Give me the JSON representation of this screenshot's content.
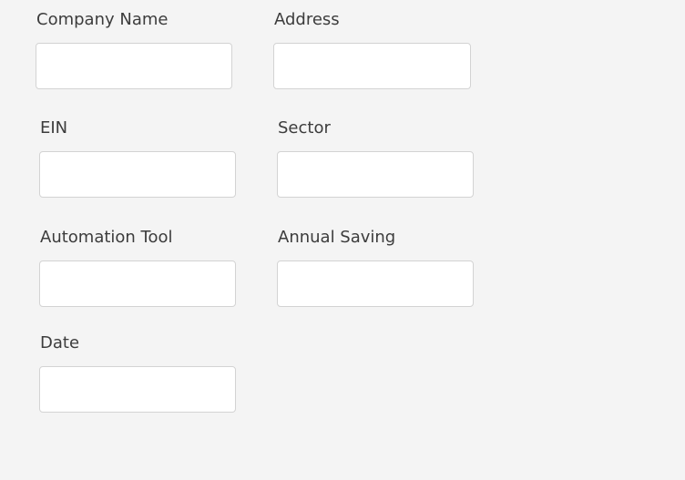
{
  "form": {
    "company_name": {
      "label": "Company Name",
      "value": "",
      "placeholder": ""
    },
    "address": {
      "label": "Address",
      "value": "",
      "placeholder": ""
    },
    "ein": {
      "label": "EIN",
      "value": "",
      "placeholder": ""
    },
    "sector": {
      "label": "Sector",
      "value": "",
      "placeholder": ""
    },
    "automation_tool": {
      "label": "Automation Tool",
      "value": "",
      "placeholder": ""
    },
    "annual_saving": {
      "label": "Annual Saving",
      "value": "",
      "placeholder": ""
    },
    "date": {
      "label": "Date",
      "value": "",
      "placeholder": ""
    }
  }
}
